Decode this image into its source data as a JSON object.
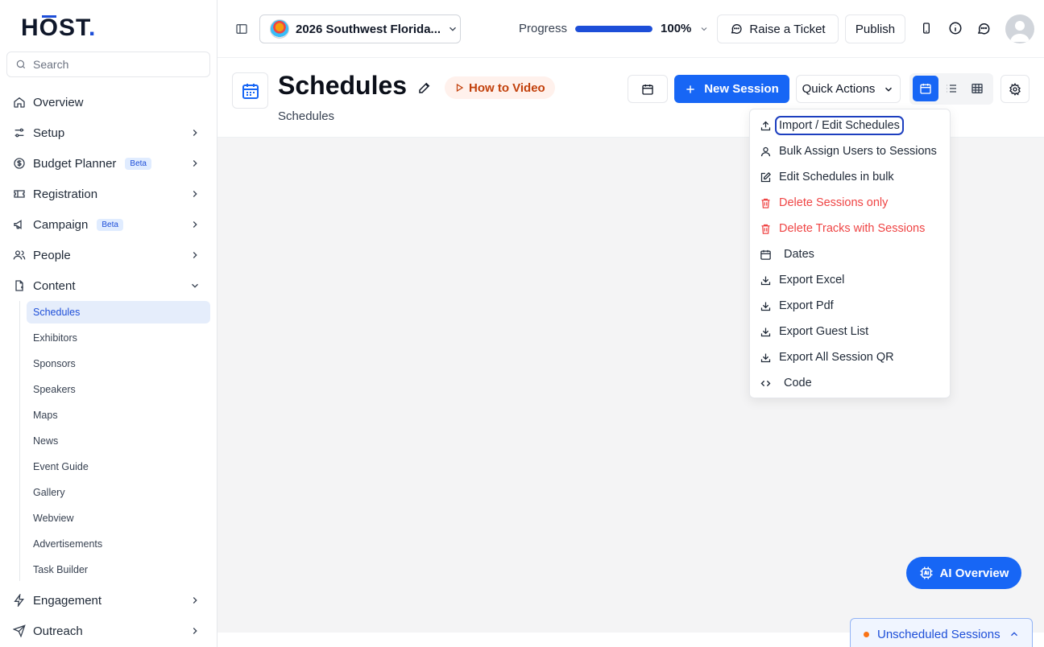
{
  "brand": {
    "logo_text": "HŌST."
  },
  "sidebar": {
    "search_placeholder": "Search",
    "items": [
      {
        "label": "Overview",
        "icon": "home-icon"
      },
      {
        "label": "Setup",
        "icon": "sliders-icon"
      },
      {
        "label": "Budget Planner",
        "icon": "dollar-icon",
        "badge": "Beta"
      },
      {
        "label": "Registration",
        "icon": "ticket-icon"
      },
      {
        "label": "Campaign",
        "icon": "megaphone-icon",
        "badge": "Beta"
      },
      {
        "label": "People",
        "icon": "users-icon"
      },
      {
        "label": "Content",
        "icon": "document-icon"
      },
      {
        "label": "Engagement",
        "icon": "zap-icon"
      },
      {
        "label": "Outreach",
        "icon": "send-icon"
      }
    ],
    "content_children": [
      "Schedules",
      "Exhibitors",
      "Sponsors",
      "Speakers",
      "Maps",
      "News",
      "Event Guide",
      "Gallery",
      "Webview",
      "Advertisements",
      "Task Builder"
    ]
  },
  "topbar": {
    "event_name": "2026 Southwest Florida...",
    "progress_label": "Progress",
    "progress_value": "100%",
    "progress_fraction": 1.0,
    "raise_ticket": "Raise a Ticket",
    "publish": "Publish"
  },
  "header": {
    "title": "Schedules",
    "how_to_video": "How to Video",
    "breadcrumb": "Schedules",
    "new_session": "New Session",
    "quick_actions": "Quick Actions"
  },
  "quick_actions_menu": [
    {
      "label": "Import / Edit Schedules",
      "icon": "upload-icon",
      "style": "normal"
    },
    {
      "label": "Bulk Assign Users to Sessions",
      "icon": "user-icon",
      "style": "normal"
    },
    {
      "label": "Edit Schedules in bulk",
      "icon": "edit-icon",
      "style": "normal"
    },
    {
      "label": "Delete Sessions only",
      "icon": "trash-icon",
      "style": "danger"
    },
    {
      "label": "Delete Tracks with Sessions",
      "icon": "trash-icon",
      "style": "danger"
    },
    {
      "label": "Dates",
      "icon": "calendar-icon",
      "style": "normal"
    },
    {
      "label": "Export Excel",
      "icon": "download-icon",
      "style": "normal"
    },
    {
      "label": "Export Pdf",
      "icon": "download-icon",
      "style": "normal"
    },
    {
      "label": "Export Guest List",
      "icon": "download-icon",
      "style": "normal"
    },
    {
      "label": "Export All Session QR",
      "icon": "download-icon",
      "style": "normal"
    },
    {
      "label": "Code",
      "icon": "code-icon",
      "style": "normal"
    }
  ],
  "floating": {
    "ai_overview": "AI Overview",
    "unscheduled_sessions": "Unscheduled Sessions"
  },
  "colors": {
    "primary": "#1766f5",
    "danger": "#ef4444",
    "accent_orange": "#c2410c"
  }
}
